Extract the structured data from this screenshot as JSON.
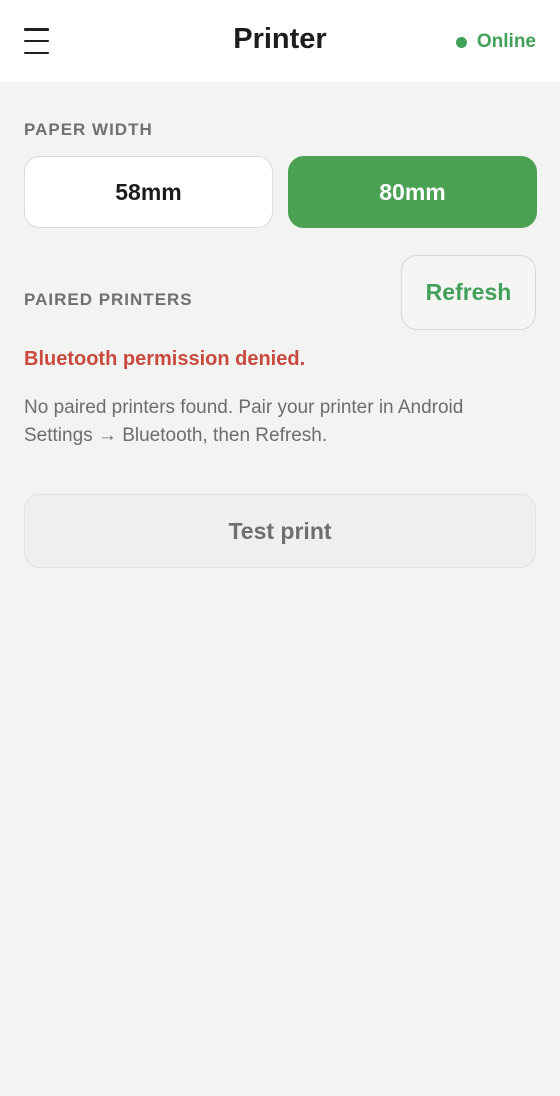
{
  "header": {
    "title": "Printer",
    "status": "Online",
    "status_color": "#43a05a",
    "menu_icon": "hamburger-menu-icon"
  },
  "paper_width": {
    "label": "PAPER WIDTH",
    "options": [
      "58mm",
      "80mm"
    ],
    "selected": "80mm",
    "accent_color": "#4aa153"
  },
  "paired_printers": {
    "label": "PAIRED PRINTERS",
    "refresh_label": "Refresh",
    "error": "Bluetooth permission denied.",
    "error_color": "#c84a3e",
    "hint": "No paired printers found. Pair your printer in Android Settings → Bluetooth, then Refresh."
  },
  "actions": {
    "test_print_label": "Test print"
  }
}
